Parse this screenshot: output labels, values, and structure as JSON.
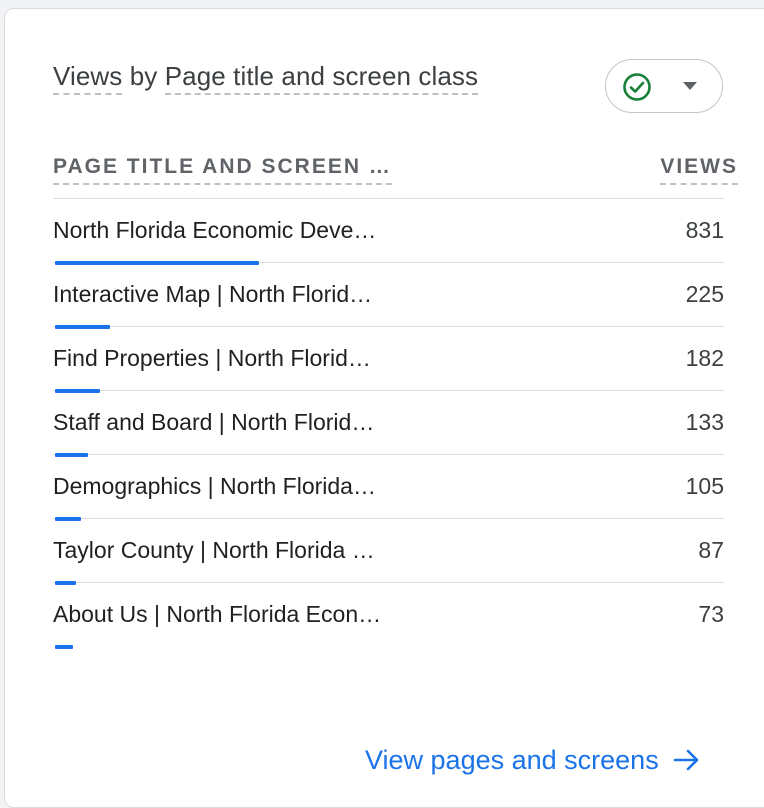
{
  "card": {
    "title_prefix": "Views",
    "title_middle": " by ",
    "title_dimension": "Page title and screen class"
  },
  "table": {
    "col_dimension": "PAGE TITLE AND SCREEN …",
    "col_metric": "VIEWS",
    "max_value": 831,
    "rows": [
      {
        "label": "North Florida Economic Deve…",
        "value": "831",
        "fraction": 1.0
      },
      {
        "label": "Interactive Map | North Florid…",
        "value": "225",
        "fraction": 0.271
      },
      {
        "label": "Find Properties | North Florid…",
        "value": "182",
        "fraction": 0.219
      },
      {
        "label": "Staff and Board | North Florid…",
        "value": "133",
        "fraction": 0.16
      },
      {
        "label": "Demographics | North Florida…",
        "value": "105",
        "fraction": 0.126
      },
      {
        "label": "Taylor County | North Florida …",
        "value": "87",
        "fraction": 0.105
      },
      {
        "label": "About Us | North Florida Econ…",
        "value": "73",
        "fraction": 0.088
      }
    ]
  },
  "footer": {
    "link_label": "View pages and screens"
  },
  "icons": {
    "status": "check-circle-icon",
    "dropdown": "caret-down-icon",
    "link": "arrow-right-icon"
  },
  "colors": {
    "accent": "#1a73e8",
    "status_green": "#188038"
  }
}
